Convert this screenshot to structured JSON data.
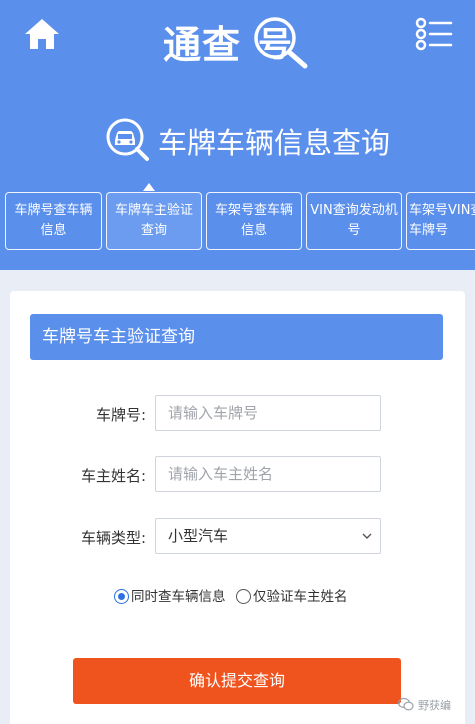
{
  "header": {
    "logo_text": "通查",
    "logo_last_char": "号"
  },
  "hero": {
    "title": "车牌车辆信息查询",
    "tabs": [
      {
        "label": "车牌号查车辆\n信息",
        "active": false
      },
      {
        "label": "车牌车主验证\n查询",
        "active": true
      },
      {
        "label": "车架号查车辆\n信息",
        "active": false
      },
      {
        "label": "VIN查询发动机\n号",
        "active": false
      },
      {
        "label": "车架号VIN查\n车牌号",
        "active": false
      }
    ]
  },
  "form": {
    "section_title": "车牌号车主验证查询",
    "plate_label": "车牌号:",
    "plate_placeholder": "请输入车牌号",
    "owner_label": "车主姓名:",
    "owner_placeholder": "请输入车主姓名",
    "type_label": "车辆类型:",
    "type_value": "小型汽车",
    "radio_options": [
      {
        "label": "同时查车辆信息",
        "checked": true
      },
      {
        "label": "仅验证车主姓名",
        "checked": false
      }
    ],
    "submit_label": "确认提交查询"
  },
  "watermark": {
    "text": "野获编"
  },
  "colors": {
    "brand_blue": "#5b8fec",
    "submit_orange": "#f0541e",
    "radio_blue": "#2f6fe0"
  },
  "icons": [
    "home-icon",
    "magnifier-icon",
    "menu-list-icon",
    "car-search-icon",
    "chevron-down-icon",
    "wechat-icon"
  ]
}
